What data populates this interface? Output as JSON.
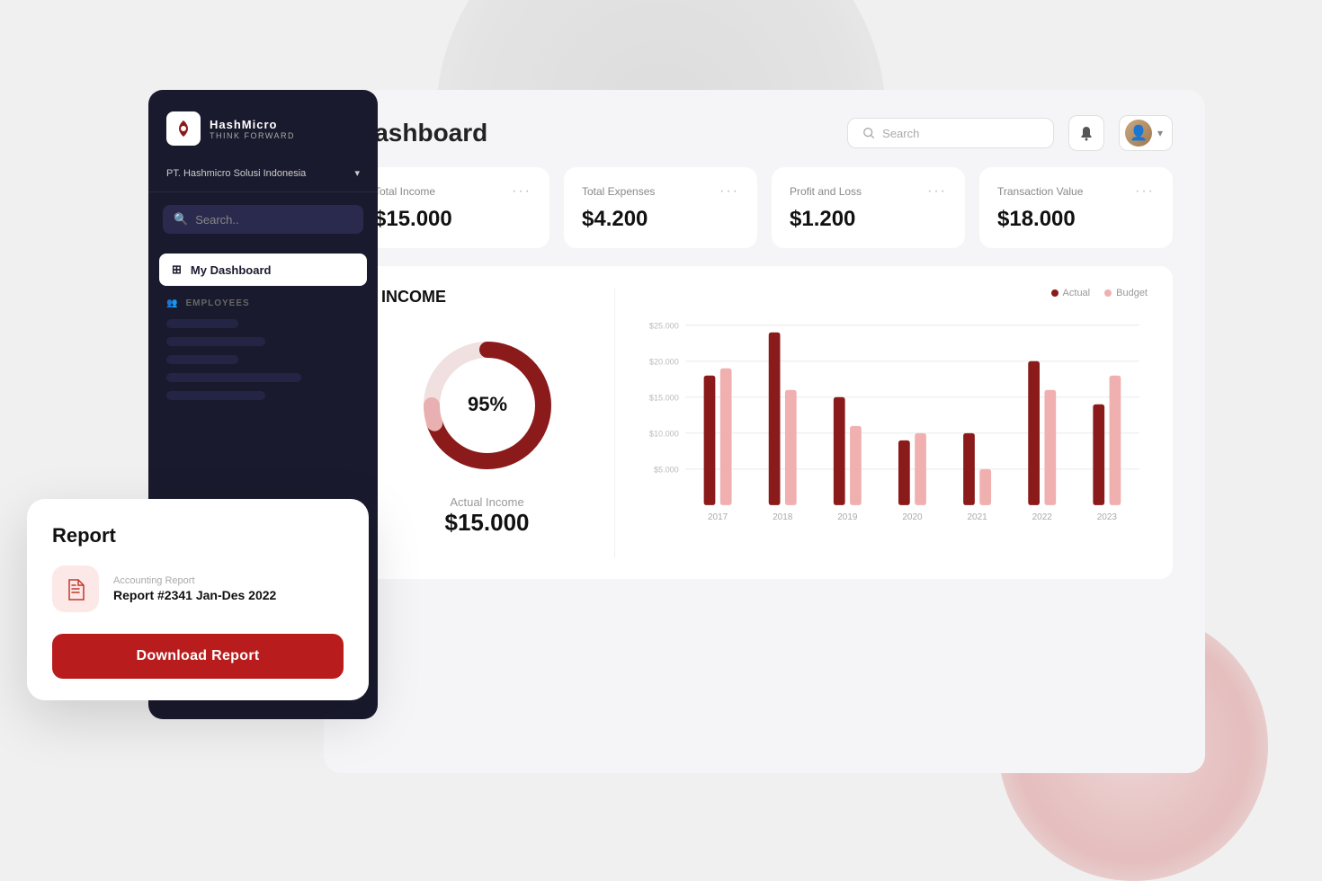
{
  "app": {
    "name": "HashMicro",
    "tagline": "THINK FORWARD"
  },
  "sidebar": {
    "company": "PT. Hashmicro Solusi Indonesia",
    "search_placeholder": "Search..",
    "active_item": "My Dashboard",
    "section_label": "EMPLOYEES"
  },
  "header": {
    "title": "Dashboard",
    "search_placeholder": "Search"
  },
  "kpi_cards": [
    {
      "label": "Total Income",
      "value": "$15.000"
    },
    {
      "label": "Total Expenses",
      "value": "$4.200"
    },
    {
      "label": "Profit and Loss",
      "value": "$1.200"
    },
    {
      "label": "Transaction Value",
      "value": "$18.000"
    }
  ],
  "income_chart": {
    "title": "INCOME",
    "donut_percent": "95%",
    "donut_value_percent": 95,
    "actual_label": "Actual Income",
    "actual_value": "$15.000",
    "legend": {
      "actual_label": "Actual",
      "budget_label": "Budget",
      "actual_color": "#8b1a1a",
      "budget_color": "#f0b0b0"
    },
    "bar_data": [
      {
        "year": "2017",
        "actual": 18000,
        "budget": 19000
      },
      {
        "year": "2018",
        "actual": 24000,
        "budget": 16000
      },
      {
        "year": "2019",
        "actual": 15000,
        "budget": 11000
      },
      {
        "year": "2020",
        "actual": 9000,
        "budget": 10000
      },
      {
        "year": "2021",
        "actual": 10000,
        "budget": 5000
      },
      {
        "year": "2022",
        "actual": 20000,
        "budget": 16000
      },
      {
        "year": "2023",
        "actual": 14000,
        "budget": 18000
      }
    ],
    "y_axis": [
      "$25.000",
      "$20.000",
      "$15.000",
      "$10.000",
      "$5000"
    ]
  },
  "report_popup": {
    "title": "Report",
    "report_type": "Accounting Report",
    "report_name": "Report #2341 Jan-Des 2022",
    "download_label": "Download Report"
  }
}
